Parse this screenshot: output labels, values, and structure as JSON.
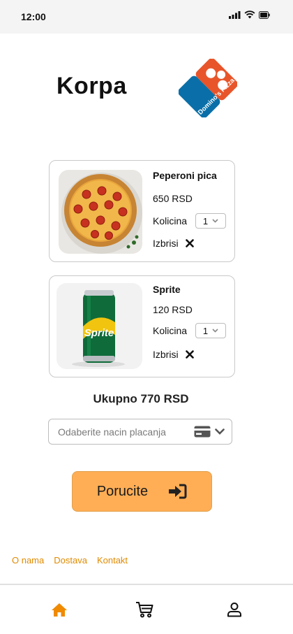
{
  "status_bar": {
    "time": "12:00"
  },
  "header": {
    "title": "Korpa",
    "logo_text": "Domino's Pizza"
  },
  "cart": {
    "items": [
      {
        "name": "Peperoni pica",
        "price": "650 RSD",
        "quantity_label": "Kolicina",
        "quantity": "1",
        "remove_label": "Izbrisi",
        "image": "pepperoni-pizza"
      },
      {
        "name": "Sprite",
        "price": "120 RSD",
        "quantity_label": "Kolicina",
        "quantity": "1",
        "remove_label": "Izbrisi",
        "image": "sprite-can"
      }
    ],
    "total": "Ukupno 770 RSD"
  },
  "payment": {
    "placeholder": "Odaberite nacin placanja",
    "icon": "credit-card-icon"
  },
  "order_button": {
    "label": "Porucite",
    "icon": "sign-in-icon"
  },
  "footer": {
    "links": [
      "O nama",
      "Dostava",
      "Kontakt"
    ]
  },
  "bottom_nav": {
    "items": [
      {
        "name": "home",
        "icon": "home-icon",
        "active": true
      },
      {
        "name": "cart",
        "icon": "cart-icon",
        "active": false
      },
      {
        "name": "profile",
        "icon": "user-icon",
        "active": false
      }
    ]
  },
  "colors": {
    "accent": "#ffae55",
    "link": "#e08a00",
    "active_nav": "#f08a00",
    "brand_blue": "#0a6fa8",
    "brand_red": "#e8552a"
  }
}
